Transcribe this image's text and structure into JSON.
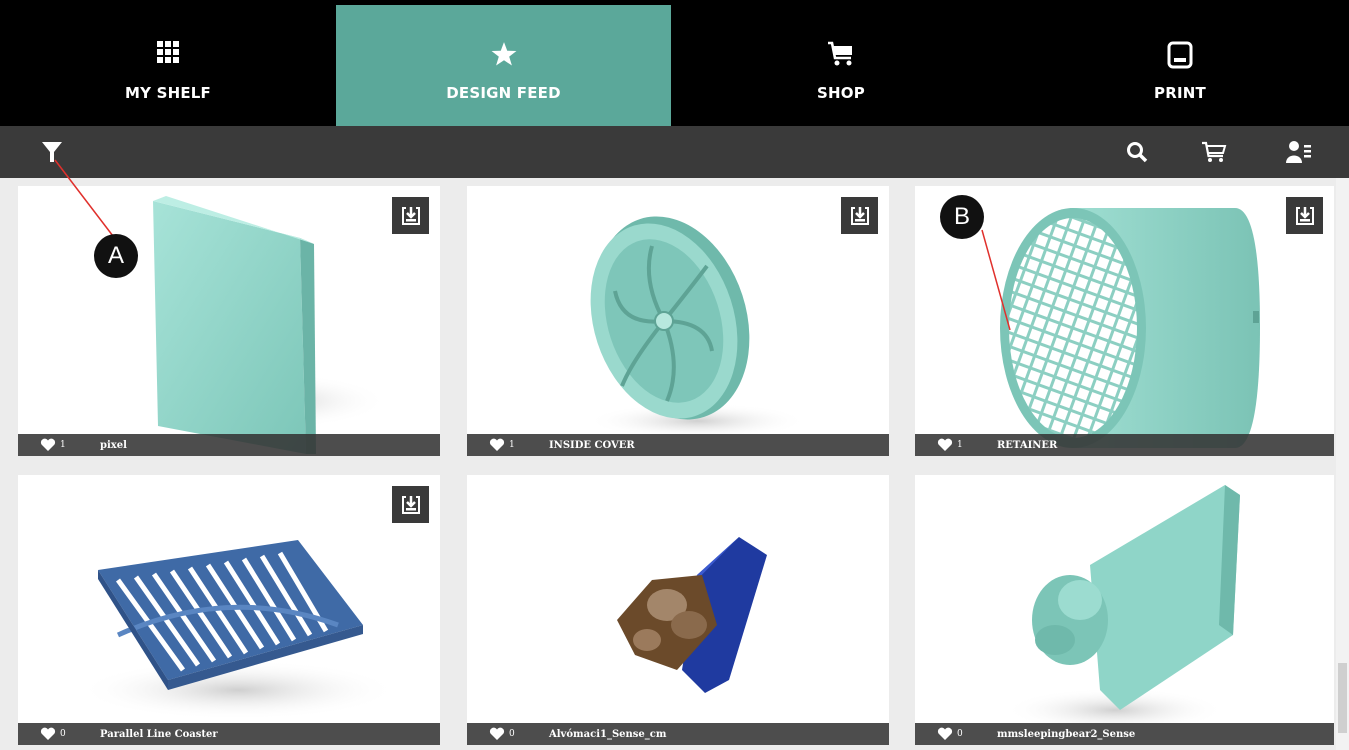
{
  "nav": {
    "tabs": [
      {
        "label": "MY SHELF",
        "icon": "grid-icon"
      },
      {
        "label": "DESIGN FEED",
        "icon": "star-icon",
        "active": true
      },
      {
        "label": "SHOP",
        "icon": "cart-icon"
      },
      {
        "label": "PRINT",
        "icon": "printer-icon"
      }
    ]
  },
  "toolbar": {
    "filter_icon": "filter-icon",
    "search_icon": "search-icon",
    "cart_icon": "cart-icon",
    "account_icon": "account-icon"
  },
  "cards": [
    {
      "likes": "1",
      "title": "pixel",
      "download": true
    },
    {
      "likes": "1",
      "title": "INSIDE COVER",
      "download": true
    },
    {
      "likes": "1",
      "title": "RETAINER",
      "download": true
    },
    {
      "likes": "0",
      "title": "Parallel Line Coaster",
      "download": true
    },
    {
      "likes": "0",
      "title": "Alvómaci1_Sense_cm",
      "download": false
    },
    {
      "likes": "0",
      "title": "mmsleepingbear2_Sense",
      "download": false
    }
  ],
  "callouts": {
    "a": "A",
    "b": "B"
  },
  "colors": {
    "accent": "#5ba89a",
    "model": "#8fd5c8",
    "coaster": "#4a74b0",
    "topbar": "#000000",
    "toolbar": "#3a3a3a"
  }
}
